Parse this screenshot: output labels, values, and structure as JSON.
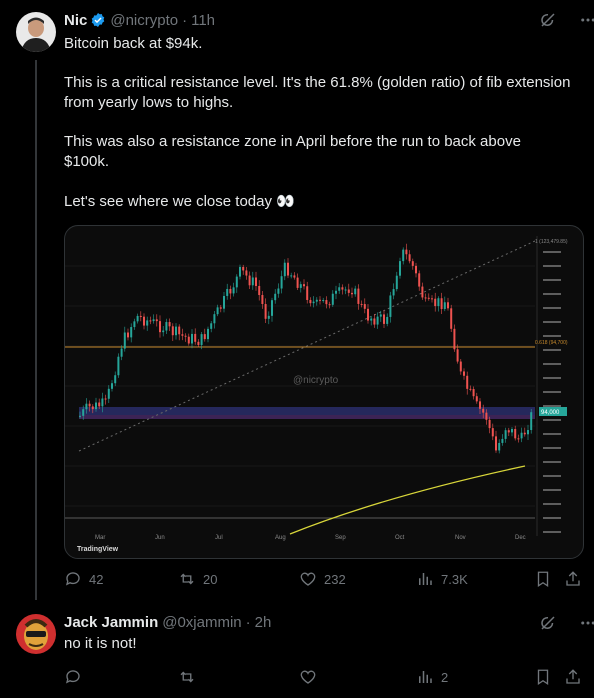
{
  "post": {
    "author_name": "Nic",
    "author_handle": "@nicrypto",
    "time_sep": "·",
    "time": "11h",
    "lines": [
      "Bitcoin back at $94k.",
      "This is a critical resistance level. It's the 61.8% (golden ratio) of fib extension from yearly lows to highs.",
      "This was also a resistance zone in April before the run to back above $100k.",
      "Let's see where we close today 👀"
    ],
    "chart": {
      "watermark": "@nicrypto",
      "brand": "TradingView",
      "month_labels": [
        "Mar",
        "Jun",
        "Jul",
        "Aug",
        "Sep",
        "Oct",
        "Nov",
        "Dec"
      ],
      "fib_label_top": "1 (123,479.85)",
      "fib_label_mid": "0.618 (94,700)",
      "price_tag": "94,000"
    },
    "stats": {
      "replies": "42",
      "reposts": "20",
      "likes": "232",
      "views": "7.3K"
    }
  },
  "reply": {
    "author_name": "Jack Jammin",
    "author_handle": "@0xjammin",
    "time_sep": "·",
    "time": "2h",
    "text": "no it is not!",
    "stats": {
      "views": "2"
    }
  },
  "colors": {
    "verified": "#1d9bf0",
    "candle_up": "#26a69a",
    "candle_down": "#ef5350",
    "fib_line": "#c78a2c",
    "ma_line": "#d8d63a",
    "zone": "#3b3f9e"
  }
}
